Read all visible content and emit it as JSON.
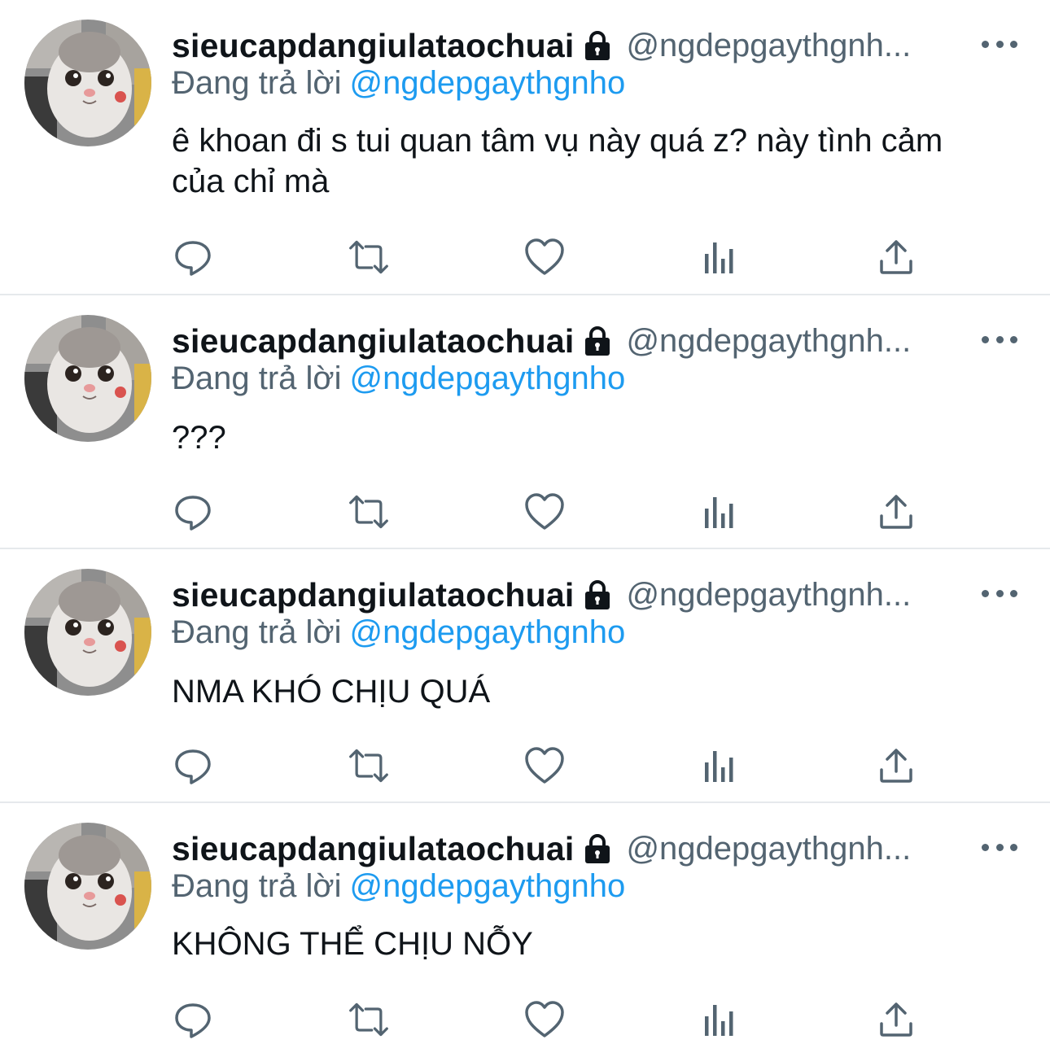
{
  "colors": {
    "text_primary": "#0f1419",
    "text_secondary": "#536471",
    "mention": "#1d9bf0",
    "divider": "#e6e9ec"
  },
  "tweets": [
    {
      "display_name": "sieucapdangiulataochuai",
      "handle": "@ngdepgaythgnh...",
      "replying_label": "Đang trả lời",
      "replying_to": "@ngdepgaythgnho",
      "text": "ê khoan đi s tui quan tâm vụ này quá z? này tình cảm của chỉ mà"
    },
    {
      "display_name": "sieucapdangiulataochuai",
      "handle": "@ngdepgaythgnh...",
      "replying_label": "Đang trả lời",
      "replying_to": "@ngdepgaythgnho",
      "text": "???"
    },
    {
      "display_name": "sieucapdangiulataochuai",
      "handle": "@ngdepgaythgnh...",
      "replying_label": "Đang trả lời",
      "replying_to": "@ngdepgaythgnho",
      "text": "NMA KHÓ CHỊU QUÁ"
    },
    {
      "display_name": "sieucapdangiulataochuai",
      "handle": "@ngdepgaythgnh...",
      "replying_label": "Đang trả lời",
      "replying_to": "@ngdepgaythgnho",
      "text": "KHÔNG THỂ CHỊU NỖY"
    }
  ],
  "action_icons": [
    "reply-icon",
    "retweet-icon",
    "like-icon",
    "analytics-icon",
    "share-icon"
  ]
}
